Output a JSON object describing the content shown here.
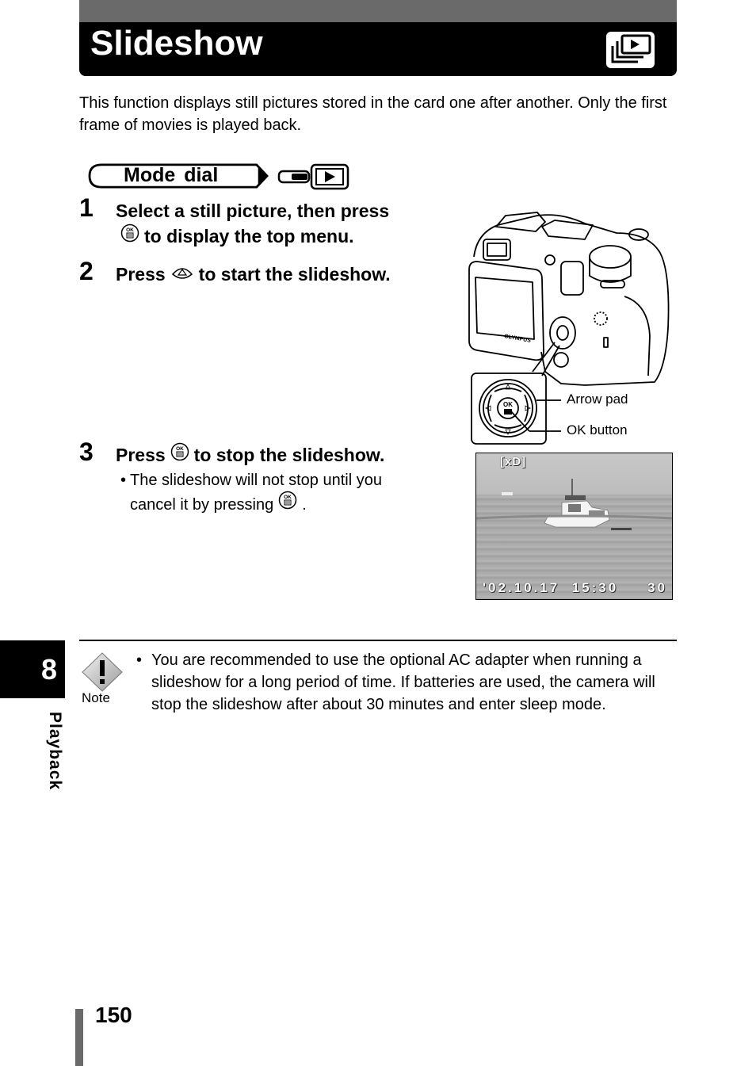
{
  "header": {
    "title": "Slideshow",
    "icon": "slideshow-icon"
  },
  "intro": "This function displays still pictures stored in the card one after another. Only the first frame of movies is played back.",
  "mode_dial": {
    "label": "Mode dial",
    "icons": [
      "mode-dial-position-icon",
      "playback-icon"
    ]
  },
  "steps": [
    {
      "number": "1",
      "line1": "Select a still picture, then press",
      "line2_icon": "ok-button-icon",
      "line2": "to display the top menu."
    },
    {
      "number": "2",
      "pre": "Press",
      "icon": "arrow-up-button-icon",
      "post": "to start the slideshow."
    },
    {
      "number": "3",
      "pre": "Press",
      "icon": "ok-button-icon",
      "post": "to stop the slideshow.",
      "sub": {
        "bullet": "•",
        "line1": "The slideshow will not stop until you",
        "line2": "cancel it by pressing",
        "line2_icon": "ok-button-icon",
        "line2_end": "."
      }
    }
  ],
  "camera_figure": {
    "brand": "OLYMPUS",
    "callouts": [
      "Arrow pad",
      "OK button"
    ]
  },
  "lcd_preview": {
    "card_indicator": "[xD]",
    "datetime": "'02.10.17  15:30",
    "frame_number": "30"
  },
  "note": {
    "label": "Note",
    "bullet": "•",
    "text": "You are recommended to use the optional AC adapter when running a slideshow for a long period of time. If batteries are used, the camera will stop the slideshow after about 30 minutes and enter sleep mode."
  },
  "chapter": {
    "number": "8",
    "label": "Playback"
  },
  "page_number": "150"
}
